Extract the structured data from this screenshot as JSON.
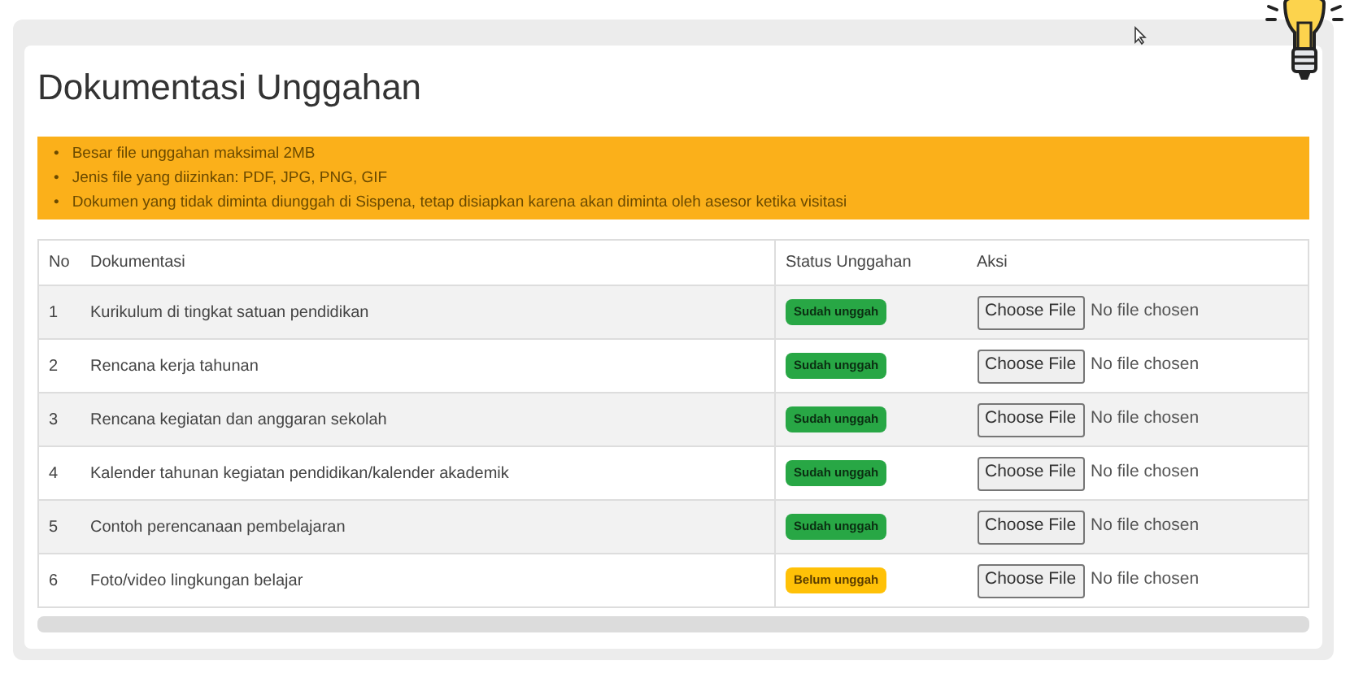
{
  "title": "Dokumentasi Unggahan",
  "notes": [
    {
      "bullet": "•",
      "text": "Besar file unggahan maksimal 2MB"
    },
    {
      "bullet": "•",
      "text": "Jenis file yang diizinkan: PDF, JPG, PNG, GIF"
    },
    {
      "bullet": "•",
      "text": "Dokumen yang tidak diminta diunggah di Sispena, tetap disiapkan karena akan diminta oleh asesor ketika visitasi"
    }
  ],
  "table": {
    "columns": [
      "No",
      "Dokumentasi",
      "Status Unggahan",
      "Aksi"
    ],
    "rows": [
      {
        "no": "1",
        "document": "Kurikulum di tingkat satuan pendidikan",
        "status": "Sudah unggah",
        "uploaded": true,
        "button": "Choose File",
        "file": "No file chosen"
      },
      {
        "no": "2",
        "document": "Rencana kerja tahunan",
        "status": "Sudah unggah",
        "uploaded": true,
        "button": "Choose File",
        "file": "No file chosen"
      },
      {
        "no": "3",
        "document": "Rencana kegiatan dan anggaran sekolah",
        "status": "Sudah unggah",
        "uploaded": true,
        "button": "Choose File",
        "file": "No file chosen"
      },
      {
        "no": "4",
        "document": "Kalender tahunan kegiatan pendidikan/kalender akademik",
        "status": "Sudah unggah",
        "uploaded": true,
        "button": "Choose File",
        "file": "No file chosen"
      },
      {
        "no": "5",
        "document": "Contoh perencanaan pembelajaran",
        "status": "Sudah unggah",
        "uploaded": true,
        "button": "Choose File",
        "file": "No file chosen"
      },
      {
        "no": "6",
        "document": "Foto/video lingkungan belajar",
        "status": "Belum unggah",
        "uploaded": false,
        "button": "Choose File",
        "file": "No file chosen"
      }
    ]
  }
}
